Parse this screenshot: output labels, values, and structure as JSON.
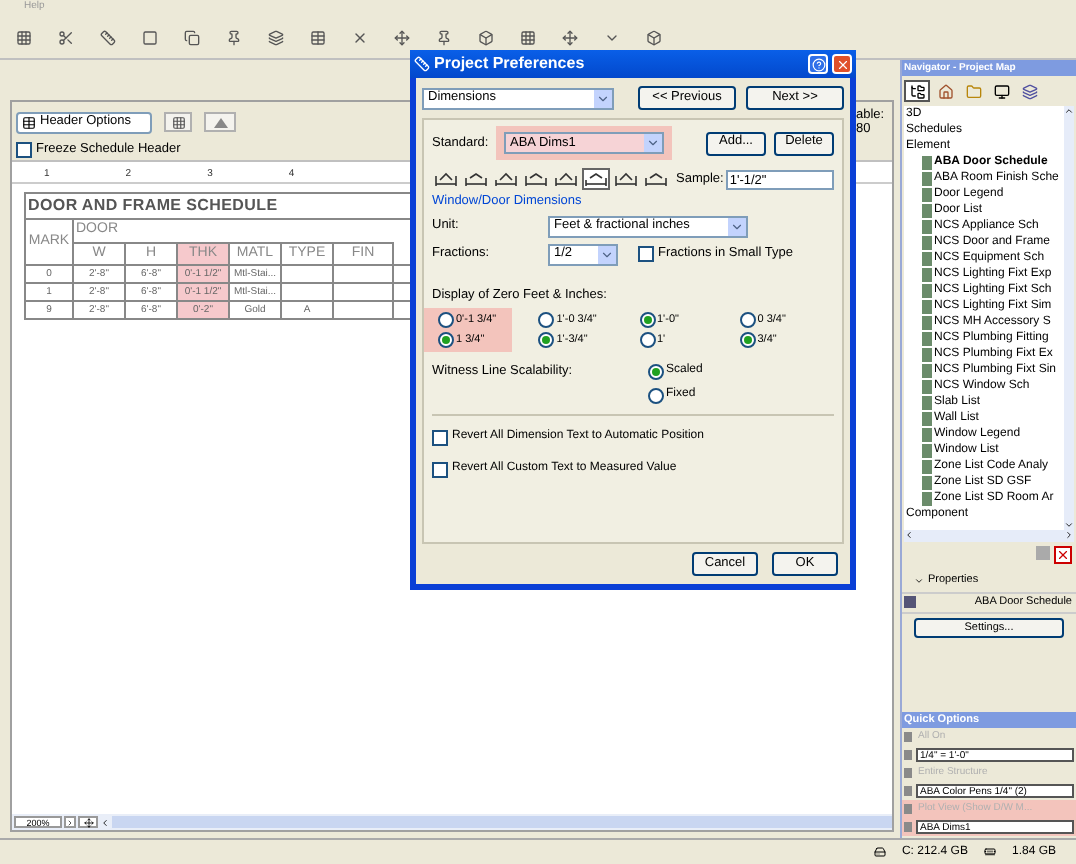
{
  "menu_bar": {
    "items": [
      "Help"
    ]
  },
  "schedule": {
    "header_options": "Header Options",
    "freeze": {
      "label": "Freeze Schedule Header",
      "checked": false
    },
    "side_label": "able:",
    "side_value": "80",
    "ruler": [
      "1",
      "2",
      "3",
      "4"
    ],
    "table": {
      "title": "DOOR AND FRAME SCHEDULE",
      "group": "DOOR",
      "columns": [
        {
          "label": "MARK",
          "highlighted": false
        },
        {
          "label": "W",
          "highlighted": false
        },
        {
          "label": "H",
          "highlighted": false
        },
        {
          "label": "THK",
          "highlighted": true
        },
        {
          "label": "MATL",
          "highlighted": false
        },
        {
          "label": "TYPE",
          "highlighted": false
        },
        {
          "label": "FIN",
          "highlighted": false
        }
      ],
      "rows": [
        [
          "0",
          "2'-8\"",
          "6'-8\"",
          "0'-1 1/2\"",
          "Mtl-Stai..."
        ],
        [
          "1",
          "2'-8\"",
          "6'-8\"",
          "0'-1 1/2\"",
          "Mtl-Stai..."
        ],
        [
          "9",
          "2'-8\"",
          "6'-8\"",
          "0'-2\"",
          "Gold",
          "A"
        ]
      ]
    },
    "zoom": "200%"
  },
  "dialog": {
    "title": "Project Preferences",
    "page": "Dimensions",
    "previous": "<< Previous",
    "next": "Next >>",
    "standard": {
      "label": "Standard:",
      "value": "ABA Dims1",
      "highlighted": true
    },
    "add": "Add...",
    "delete": "Delete",
    "styles": [
      {
        "selected": false
      },
      {
        "selected": false
      },
      {
        "selected": false
      },
      {
        "selected": false
      },
      {
        "selected": false
      },
      {
        "selected": true
      },
      {
        "selected": false
      },
      {
        "selected": false
      }
    ],
    "sample": {
      "label": "Sample:",
      "value": "1'-1/2\""
    },
    "section": "Window/Door Dimensions",
    "unit": {
      "label": "Unit:",
      "value": "Feet & fractional inches"
    },
    "fractions": {
      "label": "Fractions:",
      "value": "1/2"
    },
    "small_type": {
      "label": "Fractions in Small Type",
      "checked": false
    },
    "zero_display": {
      "label": "Display of Zero Feet & Inches:",
      "groups": [
        {
          "highlighted": true,
          "options": [
            {
              "label": "0'-1 3/4\"",
              "selected": false
            },
            {
              "label": "1 3/4\"",
              "selected": true
            }
          ]
        },
        {
          "highlighted": false,
          "options": [
            {
              "label": "1'-0 3/4\"",
              "selected": false
            },
            {
              "label": "1'-3/4\"",
              "selected": true
            }
          ]
        },
        {
          "highlighted": false,
          "options": [
            {
              "label": "1'-0\"",
              "selected": true
            },
            {
              "label": "1'",
              "selected": false
            }
          ]
        },
        {
          "highlighted": false,
          "options": [
            {
              "label": "0 3/4\"",
              "selected": false
            },
            {
              "label": "3/4\"",
              "selected": true
            }
          ]
        }
      ]
    },
    "witness": {
      "label": "Witness Line Scalability:",
      "options": [
        {
          "label": "Scaled",
          "selected": true
        },
        {
          "label": "Fixed",
          "selected": false
        }
      ]
    },
    "checkboxes": [
      {
        "label": "Revert All Dimension Text to Automatic Position",
        "checked": false
      },
      {
        "label": "Revert All Custom Text to Measured Value",
        "checked": false
      }
    ],
    "cancel": "Cancel",
    "ok": "OK"
  },
  "navigator": {
    "title": "Navigator - Project Map",
    "tree": [
      {
        "label": "3D"
      },
      {
        "label": "Schedules"
      },
      {
        "label": "Element",
        "children": [
          {
            "label": "ABA Door Schedule",
            "selected": true
          },
          {
            "label": "ABA Room Finish Sche",
            "selected": false
          },
          {
            "label": "Door Legend",
            "selected": false
          },
          {
            "label": "Door List",
            "selected": false
          },
          {
            "label": "NCS Appliance Sch",
            "selected": false
          },
          {
            "label": "NCS Door and Frame",
            "selected": false
          },
          {
            "label": "NCS Equipment Sch",
            "selected": false
          },
          {
            "label": "NCS Lighting Fixt Exp",
            "selected": false
          },
          {
            "label": "NCS Lighting Fixt Sch",
            "selected": false
          },
          {
            "label": "NCS Lighting Fixt Sim",
            "selected": false
          },
          {
            "label": "NCS MH Accessory S",
            "selected": false
          },
          {
            "label": "NCS Plumbing Fitting",
            "selected": false
          },
          {
            "label": "NCS Plumbing Fixt Ex",
            "selected": false
          },
          {
            "label": "NCS Plumbing Fixt Sin",
            "selected": false
          },
          {
            "label": "NCS Window Sch",
            "selected": false
          },
          {
            "label": "Slab List",
            "selected": false
          },
          {
            "label": "Wall List",
            "selected": false
          },
          {
            "label": "Window Legend",
            "selected": false
          },
          {
            "label": "Window List",
            "selected": false
          },
          {
            "label": "Zone List Code Analy",
            "selected": false
          },
          {
            "label": "Zone List SD GSF",
            "selected": false
          },
          {
            "label": "Zone List SD Room Ar",
            "selected": false
          }
        ]
      },
      {
        "label": "Component"
      }
    ],
    "properties": {
      "label": "Properties",
      "value": "ABA Door Schedule",
      "settings": "Settings..."
    },
    "quick_options": {
      "title": "Quick Options",
      "items": [
        {
          "label": "All On",
          "disabled": true,
          "highlighted": false
        },
        {
          "label": "1/4\"  =  1'-0\"",
          "disabled": false,
          "highlighted": false
        },
        {
          "label": "Entire Structure",
          "disabled": true,
          "highlighted": false
        },
        {
          "label": "ABA Color Pens 1/4\" (2)",
          "disabled": false,
          "highlighted": false
        },
        {
          "label": "Plot View (Show D/W M...",
          "disabled": true,
          "highlighted": true
        },
        {
          "label": "ABA Dims1",
          "disabled": false,
          "highlighted": true
        }
      ]
    }
  },
  "status_bar": {
    "disk": "C: 212.4 GB",
    "memory": "1.84 GB"
  }
}
